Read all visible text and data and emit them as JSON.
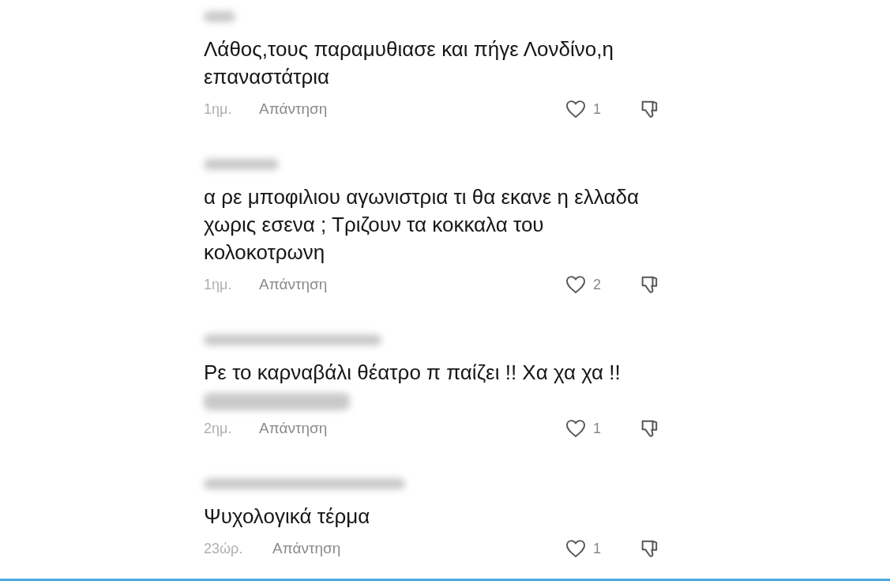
{
  "comments": [
    {
      "text": "Λάθος,τους παραμυθιασε και πήγε Λονδίνο,η επαναστάτρια",
      "extra_blurred_line": false,
      "time": "1ημ.",
      "reply": "Απάντηση",
      "likes": "1"
    },
    {
      "text": "α ρε μποφιλιου αγωνιστρια τι θα εκανε η ελλαδα χωρις εσενα ; Τριζουν τα κοκκαλα του κολοκοτρωνη",
      "extra_blurred_line": false,
      "time": "1ημ.",
      "reply": "Απάντηση",
      "likes": "2"
    },
    {
      "text": "Ρε το καρναβάλι θέατρο π παίζει !! Χα χα χα !!",
      "extra_blurred_line": true,
      "time": "2ημ.",
      "reply": "Απάντηση",
      "likes": "1"
    },
    {
      "text": "Ψυχολογικά τέρμα",
      "extra_blurred_line": false,
      "time": "23ώρ.",
      "reply": "Απάντηση",
      "likes": "1"
    }
  ]
}
